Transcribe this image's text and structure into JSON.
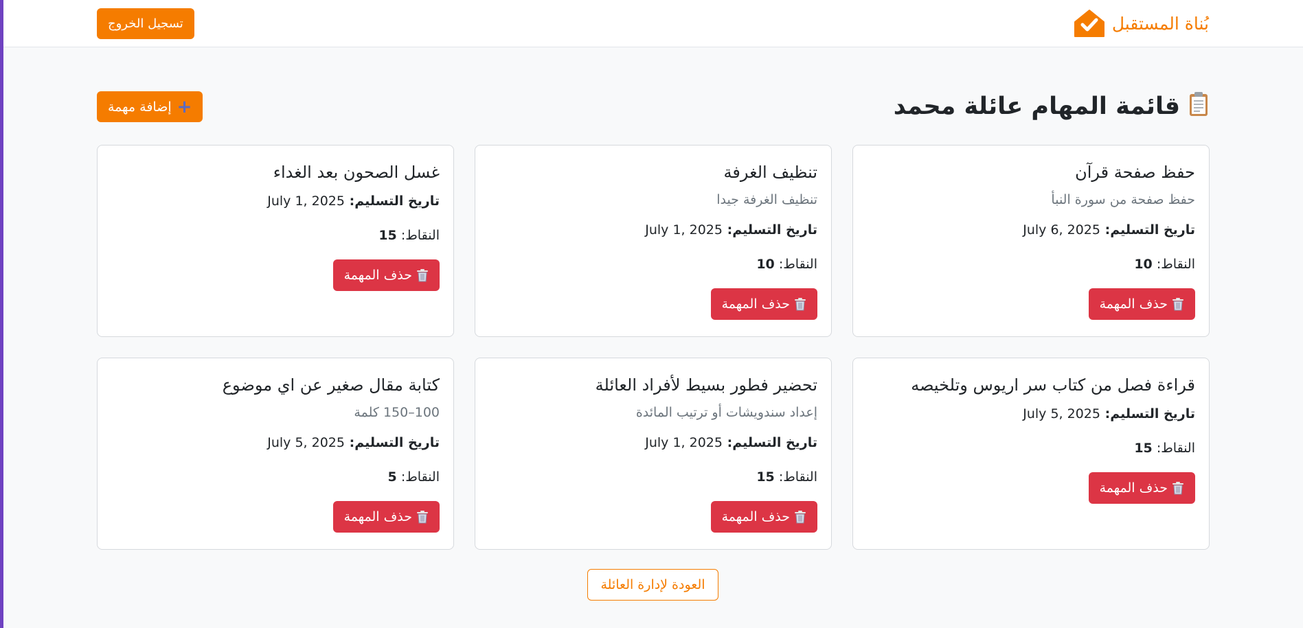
{
  "navbar": {
    "brand_name": "بُناة المستقبل",
    "brand_icon": "house-check-icon",
    "logout_label": "تسجيل الخروج"
  },
  "header": {
    "title": "قائمة المهام عائلة محمد",
    "title_icon": "clipboard-icon",
    "add_task_label": "إضافة مهمة",
    "add_icon": "plus-icon"
  },
  "labels": {
    "due_date": "تاريخ التسليم:",
    "points": "النقاط:",
    "delete": "حذف المهمة"
  },
  "tasks": [
    {
      "title": "حفظ صفحة قرآن",
      "description": "حفظ صفحة من سورة النبأ",
      "due_date": "July 6, 2025",
      "points": "10"
    },
    {
      "title": "تنظيف الغرفة",
      "description": "تنظيف الغرفة جيدا",
      "due_date": "July 1, 2025",
      "points": "10"
    },
    {
      "title": "غسل الصحون بعد الغداء",
      "description": "",
      "due_date": "July 1, 2025",
      "points": "15"
    },
    {
      "title": "قراءة فصل من كتاب سر اريوس وتلخيصه",
      "description": "",
      "due_date": "July 5, 2025",
      "points": "15"
    },
    {
      "title": "تحضير فطور بسيط لأفراد العائلة",
      "description": "إعداد سندويشات أو ترتيب المائدة",
      "due_date": "July 1, 2025",
      "points": "15"
    },
    {
      "title": "كتابة مقال صغير عن اي موضوع",
      "description": "100–150 كلمة",
      "due_date": "July 5, 2025",
      "points": "5"
    }
  ],
  "footer": {
    "back_label": "العودة لإدارة العائلة"
  },
  "colors": {
    "brand": "#f57c00",
    "danger": "#dc3545",
    "accent": "#6f42c1"
  }
}
